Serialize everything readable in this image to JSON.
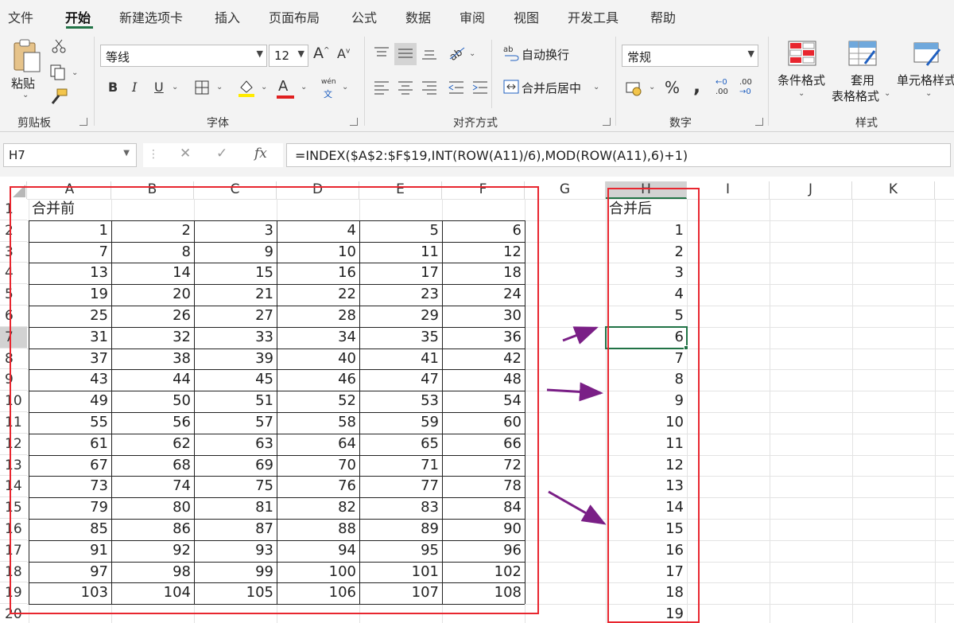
{
  "menu": {
    "tabs": [
      "文件",
      "开始",
      "新建选项卡",
      "插入",
      "页面布局",
      "公式",
      "数据",
      "审阅",
      "视图",
      "开发工具",
      "帮助"
    ],
    "active": "开始"
  },
  "ribbon": {
    "clipboard": {
      "paste_label": "粘贴",
      "group_label": "剪贴板"
    },
    "font": {
      "font_name": "等线",
      "font_size": "12",
      "bold": "B",
      "italic": "I",
      "underline": "U",
      "grow": "A",
      "shrink": "A",
      "font_color_letter": "A",
      "phonetic_top": "wén",
      "phonetic_bottom": "文",
      "group_label": "字体"
    },
    "alignment": {
      "wrap_text": "自动换行",
      "merge_center": "合并后居中",
      "group_label": "对齐方式"
    },
    "number": {
      "format": "常规",
      "percent": "%",
      "comma": ",",
      "increase_decimal_top": "←0",
      "increase_decimal_bottom": ".00",
      "decrease_decimal_top": ".00",
      "decrease_decimal_bottom": "→0",
      "group_label": "数字"
    },
    "styles": {
      "conditional": "条件格式",
      "table_line1": "套用",
      "table_line2": "表格格式",
      "cell_styles": "单元格样式",
      "group_label": "样式"
    }
  },
  "formula_bar": {
    "name_box": "H7",
    "cancel": "✕",
    "enter": "✓",
    "fx": "fx",
    "formula": "=INDEX($A$2:$F$19,INT(ROW(A11)/6),MOD(ROW(A11),6)+1)"
  },
  "sheet": {
    "columns": [
      "A",
      "B",
      "C",
      "D",
      "E",
      "F",
      "G",
      "H",
      "I",
      "J",
      "K"
    ],
    "rows": [
      "1",
      "2",
      "3",
      "4",
      "5",
      "6",
      "7",
      "8",
      "9",
      "10",
      "11",
      "12",
      "13",
      "14",
      "15",
      "16",
      "17",
      "18",
      "19",
      "20"
    ],
    "selected_column": "H",
    "selected_row": "7",
    "before_title": "合并前",
    "after_title": "合并后",
    "before_values": [
      [
        1,
        2,
        3,
        4,
        5,
        6
      ],
      [
        7,
        8,
        9,
        10,
        11,
        12
      ],
      [
        13,
        14,
        15,
        16,
        17,
        18
      ],
      [
        19,
        20,
        21,
        22,
        23,
        24
      ],
      [
        25,
        26,
        27,
        28,
        29,
        30
      ],
      [
        31,
        32,
        33,
        34,
        35,
        36
      ],
      [
        37,
        38,
        39,
        40,
        41,
        42
      ],
      [
        43,
        44,
        45,
        46,
        47,
        48
      ],
      [
        49,
        50,
        51,
        52,
        53,
        54
      ],
      [
        55,
        56,
        57,
        58,
        59,
        60
      ],
      [
        61,
        62,
        63,
        64,
        65,
        66
      ],
      [
        67,
        68,
        69,
        70,
        71,
        72
      ],
      [
        73,
        74,
        75,
        76,
        77,
        78
      ],
      [
        79,
        80,
        81,
        82,
        83,
        84
      ],
      [
        85,
        86,
        87,
        88,
        89,
        90
      ],
      [
        91,
        92,
        93,
        94,
        95,
        96
      ],
      [
        97,
        98,
        99,
        100,
        101,
        102
      ],
      [
        103,
        104,
        105,
        106,
        107,
        108
      ]
    ],
    "after_values": [
      1,
      2,
      3,
      4,
      5,
      6,
      7,
      8,
      9,
      10,
      11,
      12,
      13,
      14,
      15,
      16,
      17,
      18,
      19
    ],
    "accent_green": "#217346",
    "highlight_red": "#e8262f",
    "arrow_purple": "#7a1f86"
  }
}
